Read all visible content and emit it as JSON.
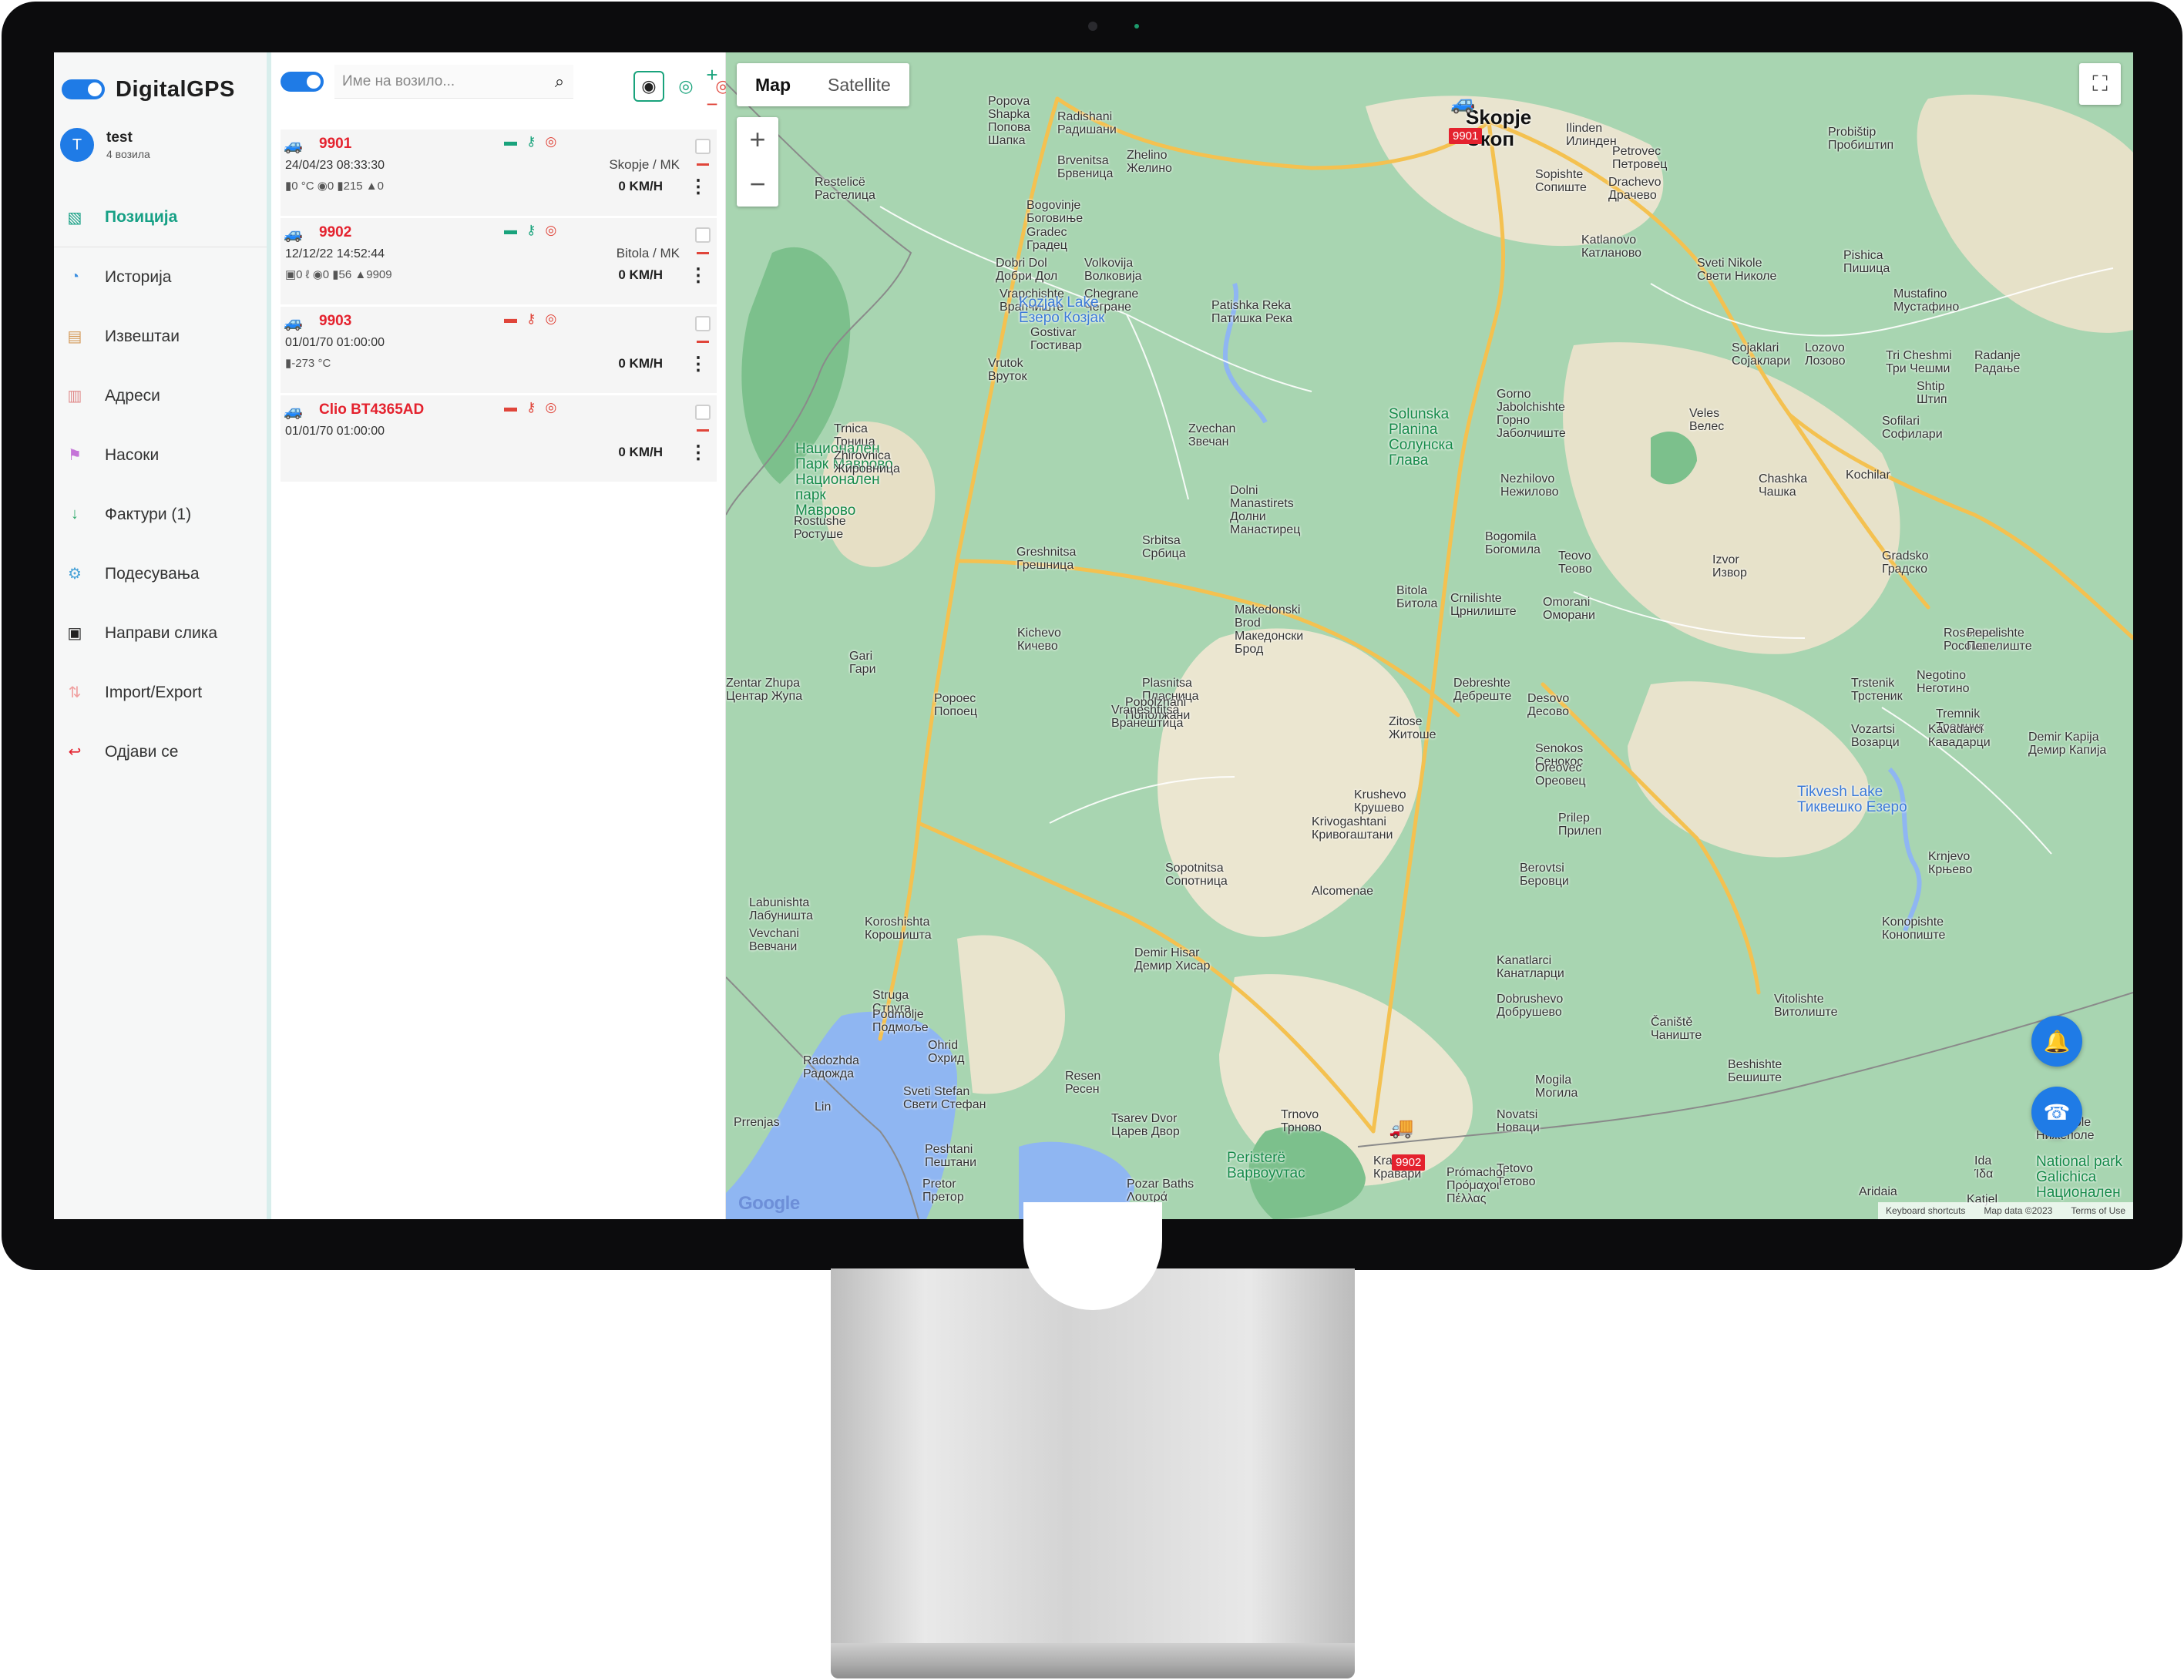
{
  "brand": {
    "name": "DigitalGPS"
  },
  "user": {
    "initial": "T",
    "name": "test",
    "subtitle": "4 возила"
  },
  "menu": [
    {
      "label": "Позиција",
      "icon": "map-position-icon",
      "color": "#16a085"
    },
    {
      "label": "Историја",
      "icon": "history-icon",
      "color": "#3b8fe0"
    },
    {
      "label": "Извештаи",
      "icon": "reports-icon",
      "color": "#d49a58"
    },
    {
      "label": "Адреси",
      "icon": "addresses-icon",
      "color": "#e08a8a"
    },
    {
      "label": "Насоки",
      "icon": "directions-icon",
      "color": "#c574d8"
    },
    {
      "label": "Фактури (1)",
      "icon": "invoices-icon",
      "color": "#2eaa6a"
    },
    {
      "label": "Подесувања",
      "icon": "settings-icon",
      "color": "#4aa3d8"
    },
    {
      "label": "Направи слика",
      "icon": "camera-icon",
      "color": "#222222"
    },
    {
      "label": "Import/Export",
      "icon": "import-export-icon",
      "color": "#f0a0a0"
    },
    {
      "label": "Одјави се",
      "icon": "logout-icon",
      "color": "#e4222e"
    }
  ],
  "vehicles_panel": {
    "search_placeholder": "Име на возило...",
    "add_symbol": "+",
    "remove_symbol": "−",
    "vehicles": [
      {
        "name": "9901",
        "time": "24/04/23 08:33:30",
        "stats": "▮0 °C ◉0 ▮215 ▲0",
        "speed": "0 KM/H",
        "location": "Skopje / MK",
        "status": "green"
      },
      {
        "name": "9902",
        "time": "12/12/22 14:52:44",
        "stats": "▣0 ℓ ◉0 ▮56 ▲9909",
        "speed": "0 KM/H",
        "location": "Bitola / MK",
        "status": "green"
      },
      {
        "name": "9903",
        "time": "01/01/70 01:00:00",
        "stats": "▮-273 °C",
        "speed": "0 KM/H",
        "location": "",
        "status": "red"
      },
      {
        "name": "Clio BT4365AD",
        "time": "01/01/70 01:00:00",
        "stats": "",
        "speed": "0 KM/H",
        "location": "",
        "status": "red"
      }
    ]
  },
  "map": {
    "type_options": [
      "Map",
      "Satellite"
    ],
    "selected_type": "Map",
    "zoom_in": "+",
    "zoom_out": "−",
    "attribution": [
      "Keyboard shortcuts",
      "Map data ©2023",
      "Terms of Use"
    ],
    "google_logo": "Google",
    "markers": [
      "9901",
      "9902"
    ],
    "places": [
      {
        "name": "Skopje\nСкоп",
        "kind": "city"
      },
      {
        "name": "Bitola\nБитола",
        "kind": "city-small"
      },
      {
        "name": "Tetovo\nТетово"
      },
      {
        "name": "Radishani\nРадишани"
      },
      {
        "name": "Popova\nShapka\nПопова\nШапка"
      },
      {
        "name": "Brvenitsa\nБрвеница"
      },
      {
        "name": "Zhelino\nЖелино"
      },
      {
        "name": "Ilinden\nИлинден"
      },
      {
        "name": "Sopishte\nСопиште"
      },
      {
        "name": "Drachevo\nДрачево"
      },
      {
        "name": "Petrovec\nПетровец"
      },
      {
        "name": "Probištip\nПробиштип"
      },
      {
        "name": "Restelicë\nРастелица"
      },
      {
        "name": "Bogovinje\nБоговиње"
      },
      {
        "name": "Gradec\nГрадец"
      },
      {
        "name": "Dobri Dol\nДобри Дол"
      },
      {
        "name": "Volkovija\nВолковија"
      },
      {
        "name": "Vrapchishte\nВрапчиште"
      },
      {
        "name": "Chegrane\nЧегране"
      },
      {
        "name": "Katlanovo\nКатланово"
      },
      {
        "name": "Sveti Nikole\nСвети Николе"
      },
      {
        "name": "Pishica\nПишица"
      },
      {
        "name": "Mustafino\nМустафино"
      },
      {
        "name": "Kozjak Lake\nЕзеро Козјак",
        "kind": "lake"
      },
      {
        "name": "Patishka Reka\nПатишка Река"
      },
      {
        "name": "Gostivar\nГостивар"
      },
      {
        "name": "Sojaklari\nСојаклари"
      },
      {
        "name": "Lozovo\nЛозово"
      },
      {
        "name": "Tri Cheshmi\nТри Чешми"
      },
      {
        "name": "Radanje\nРадање"
      },
      {
        "name": "Vrutok\nВруток"
      },
      {
        "name": "Gorno\nJabolchishte\nГорно\nЈаболчиште"
      },
      {
        "name": "Shtip\nШтип"
      },
      {
        "name": "Solunska\nPlanina\nСолунска\nГлава",
        "kind": "park"
      },
      {
        "name": "Veles\nВелес"
      },
      {
        "name": "Sofilari\nСофилари"
      },
      {
        "name": "Trnica\nТрница"
      },
      {
        "name": "Zvechan\nЗвечан"
      },
      {
        "name": "Национален\nПарк Маврово\nНационален\nпарк\nМаврово",
        "kind": "park"
      },
      {
        "name": "Zhirovnica\nЖировница"
      },
      {
        "name": "Nezhilovo\nНежилово"
      },
      {
        "name": "Kochilar"
      },
      {
        "name": "Chashka\nЧашка"
      },
      {
        "name": "Dolni\nManastirets\nДолни\nМанастирец"
      },
      {
        "name": "Rostushe\nРостуше"
      },
      {
        "name": "Bogomila\nБогомила"
      },
      {
        "name": "Srbitsa\nСрбица"
      },
      {
        "name": "Greshnitsa\nГрешница"
      },
      {
        "name": "Teovo\nТеово"
      },
      {
        "name": "Gradsko\nГрадско"
      },
      {
        "name": "Izvor\nИзвор"
      },
      {
        "name": "Crnilishte\nЦрнилиште"
      },
      {
        "name": "Omorani\nОморани"
      },
      {
        "name": "Makedonski\nBrod\nМакедонски\nБрод"
      },
      {
        "name": "Kichevo\nКичево"
      },
      {
        "name": "Rosoman\nРосоман"
      },
      {
        "name": "Pepelishte\nПепелиште"
      },
      {
        "name": "Gari\nГари"
      },
      {
        "name": "Plasnitsa\nПласница"
      },
      {
        "name": "Debreshte\nДебреште"
      },
      {
        "name": "Popolzhani\nПополжани"
      },
      {
        "name": "Trstenik\nТрстеник"
      },
      {
        "name": "Negotino\nНеготино"
      },
      {
        "name": "Zentar Zhupa\nЦентар Жупа"
      },
      {
        "name": "Desovo\nДесово"
      },
      {
        "name": "Popoec\nПопоец"
      },
      {
        "name": "Vraneshtitsa\nВранештица"
      },
      {
        "name": "Tremnik\nТремник"
      },
      {
        "name": "Vozartsi\nВозарци"
      },
      {
        "name": "Kavadarci\nКавадарци"
      },
      {
        "name": "Zitose\nЖитоше"
      },
      {
        "name": "Senokos\nСенокос"
      },
      {
        "name": "Demir Kapija\nДемир Капија"
      },
      {
        "name": "Oreovec\nОреовец"
      },
      {
        "name": "Tikvesh Lake\nТиквешко Езеро",
        "kind": "lake"
      },
      {
        "name": "Krushevo\nКрушево"
      },
      {
        "name": "Prilep\nПрилеп"
      },
      {
        "name": "Krivogashtani\nКривогаштани"
      },
      {
        "name": "Sopotnitsa\nСопотница"
      },
      {
        "name": "Berovtsi\nБеровци"
      },
      {
        "name": "Krnjevo\nКрњево"
      },
      {
        "name": "Alcomenae"
      },
      {
        "name": "Labunishta\nЛабуништа"
      },
      {
        "name": "Vevchani\nВевчани"
      },
      {
        "name": "Koroshishta\nКорошишта"
      },
      {
        "name": "Konopishte\nКонопиште"
      },
      {
        "name": "Demir Hisar\nДемир Хисар"
      },
      {
        "name": "Kanatlarci\nКанатларци"
      },
      {
        "name": "Struga\nСтруга"
      },
      {
        "name": "Podmolje\nПодмоље"
      },
      {
        "name": "Dobrushevo\nДобрушево"
      },
      {
        "name": "Vitolishte\nВитолиште"
      },
      {
        "name": "Čaniště\nЧаниште"
      },
      {
        "name": "Ohrid\nОхрид"
      },
      {
        "name": "Radozhda\nРадожда"
      },
      {
        "name": "Beshishte\nБешиште"
      },
      {
        "name": "Resen\nРесен"
      },
      {
        "name": "Mogila\nМогила"
      },
      {
        "name": "Sveti Stefan\nСвети Стефан"
      },
      {
        "name": "Lin"
      },
      {
        "name": "Trnovo\nТрново"
      },
      {
        "name": "Novatsi\nНоваци"
      },
      {
        "name": "Tsarev Dvor\nЦарев Двор"
      },
      {
        "name": "Peshtani\nПештани"
      },
      {
        "name": "Peristerë\nВарвоуvтас",
        "kind": "park"
      },
      {
        "name": "Nizhepole\nНижеполе"
      },
      {
        "name": "Kravari\nКравари"
      },
      {
        "name": "Prómachoi\nΠρόμαχοι\nΠέλλας"
      },
      {
        "name": "Ida\nΊδα"
      },
      {
        "name": "National park\nGalichica\nНационален",
        "kind": "park"
      },
      {
        "name": "Pretor\nПретор"
      },
      {
        "name": "Pozar Baths\nΛουτρά"
      },
      {
        "name": "Aridaia"
      },
      {
        "name": "Katjel"
      },
      {
        "name": "Prrenjas"
      }
    ]
  }
}
